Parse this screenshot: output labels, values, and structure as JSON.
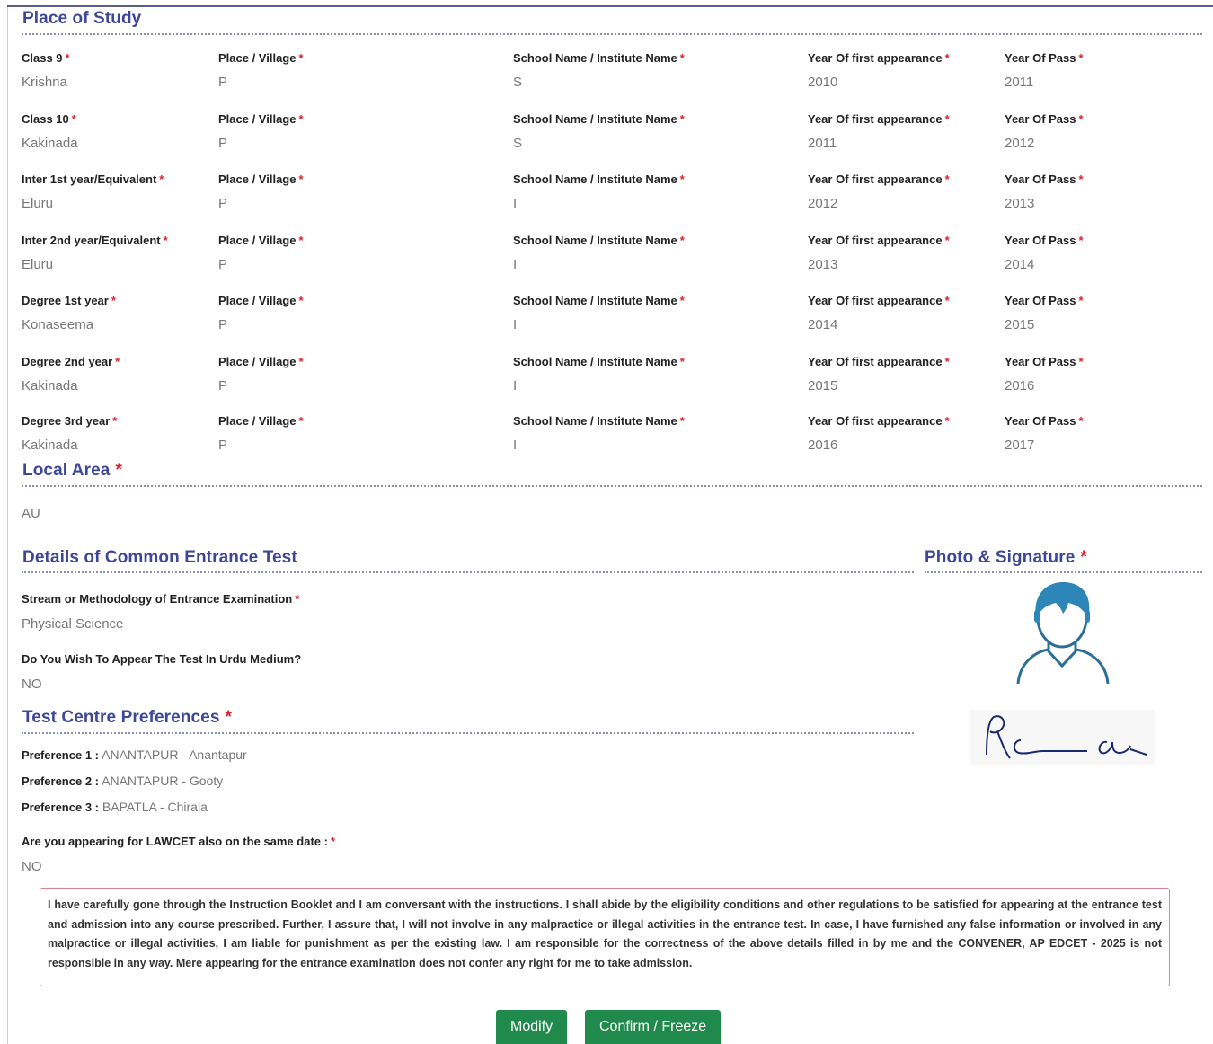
{
  "place_of_study": {
    "title": "Place of Study",
    "place_label": "Place / Village",
    "school_label": "School Name / Institute Name",
    "first_appearance_label": "Year Of first appearance",
    "pass_label": "Year Of Pass",
    "rows": [
      {
        "class_label": "Class 9",
        "district": "Krishna",
        "place": "P",
        "school": "S",
        "first_year": "2010",
        "pass_year": "2011"
      },
      {
        "class_label": "Class 10",
        "district": "Kakinada",
        "place": "P",
        "school": "S",
        "first_year": "2011",
        "pass_year": "2012"
      },
      {
        "class_label": "Inter 1st year/Equivalent",
        "district": "Eluru",
        "place": "P",
        "school": "I",
        "first_year": "2012",
        "pass_year": "2013"
      },
      {
        "class_label": "Inter 2nd year/Equivalent",
        "district": "Eluru",
        "place": "P",
        "school": "I",
        "first_year": "2013",
        "pass_year": "2014"
      },
      {
        "class_label": "Degree 1st year",
        "district": "Konaseema",
        "place": "P",
        "school": "I",
        "first_year": "2014",
        "pass_year": "2015"
      },
      {
        "class_label": "Degree 2nd year",
        "district": "Kakinada",
        "place": "P",
        "school": "I",
        "first_year": "2015",
        "pass_year": "2016"
      },
      {
        "class_label": "Degree 3rd year",
        "district": "Kakinada",
        "place": "P",
        "school": "I",
        "first_year": "2016",
        "pass_year": "2017"
      }
    ]
  },
  "local_area": {
    "title": "Local Area",
    "value": "AU"
  },
  "cet": {
    "title": "Details of Common Entrance Test",
    "stream_label": "Stream or Methodology of Entrance Examination",
    "stream_value": "Physical Science",
    "urdu_label": "Do You Wish To Appear The Test In Urdu Medium?",
    "urdu_value": "NO"
  },
  "photo_signature": {
    "title": "Photo & Signature"
  },
  "test_centre": {
    "title": "Test Centre Preferences",
    "preferences": [
      {
        "label": "Preference 1 :",
        "value": " ANANTAPUR - Anantapur"
      },
      {
        "label": "Preference 2 :",
        "value": " ANANTAPUR - Gooty"
      },
      {
        "label": "Preference 3 :",
        "value": " BAPATLA - Chirala"
      }
    ]
  },
  "lawcet": {
    "label": "Are you appearing for LAWCET also on the same date :",
    "value": "NO"
  },
  "declaration": "I have carefully gone through the Instruction Booklet and I am conversant with the instructions. I shall abide by the eligibility conditions and other regulations to be satisfied for appearing at the entrance test and admission into any course prescribed. Further, I assure that, I will not involve in any malpractice or illegal activities in the entrance test. In case, I have furnished any false information or involved in any malpractice or illegal activities, I am liable for punishment as per the existing law. I am responsible for the correctness of the above details filled in by me and the CONVENER, AP EDCET - 2025 is not responsible in any way. Mere appearing for the entrance examination does not confer any right for me to take admission.",
  "required_mark": "*",
  "buttons": {
    "modify": "Modify",
    "confirm": "Confirm / Freeze"
  },
  "colors": {
    "heading": "#3d4799",
    "required": "#d9232e",
    "button": "#1f8a4c",
    "declaration_border": "#d8868d"
  }
}
